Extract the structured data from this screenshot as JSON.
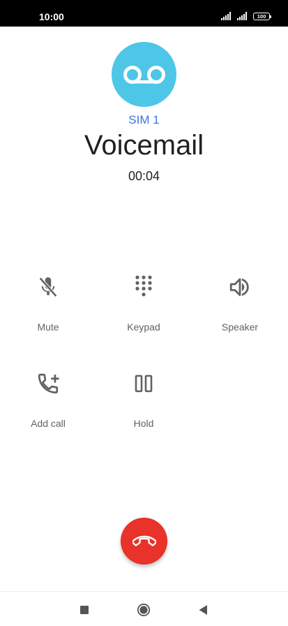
{
  "status_bar": {
    "time": "10:00",
    "battery_level": "100",
    "icons": [
      "signal-icon",
      "signal-icon",
      "battery-icon"
    ]
  },
  "caller": {
    "avatar_icon": "voicemail-icon",
    "sim_label": "SIM 1",
    "name": "Voicemail",
    "duration": "00:04"
  },
  "actions": [
    {
      "label": "Mute",
      "icon": "mic-off-icon"
    },
    {
      "label": "Keypad",
      "icon": "dialpad-icon"
    },
    {
      "label": "Speaker",
      "icon": "speaker-icon"
    },
    {
      "label": "Add call",
      "icon": "add-call-icon"
    },
    {
      "label": "Hold",
      "icon": "pause-icon"
    }
  ],
  "end_call": {
    "icon": "hang-up-icon"
  },
  "nav": {
    "icons": [
      "recents-square-icon",
      "home-circle-icon",
      "back-triangle-icon"
    ]
  },
  "colors": {
    "avatar": "#4DC6E8",
    "sim_label": "#3C78D8",
    "end_call": "#E8322A",
    "icon": "#5f6368",
    "nav_icon": "#555555"
  }
}
